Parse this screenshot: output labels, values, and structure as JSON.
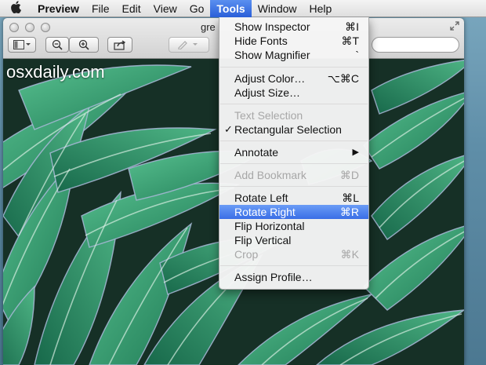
{
  "menubar": {
    "app_name": "Preview",
    "items": [
      "File",
      "Edit",
      "View",
      "Go",
      "Tools",
      "Window",
      "Help"
    ]
  },
  "window": {
    "title_partial": "gre"
  },
  "watermark": "osxdaily.com",
  "tools_menu": {
    "items": [
      {
        "label": "Show Inspector",
        "shortcut": "⌘I"
      },
      {
        "label": "Hide Fonts",
        "shortcut": "⌘T"
      },
      {
        "label": "Show Magnifier",
        "shortcut": "`"
      },
      {
        "label": "Adjust Color…",
        "shortcut": "⌥⌘C"
      },
      {
        "label": "Adjust Size…",
        "shortcut": ""
      },
      {
        "label": "Text Selection",
        "shortcut": ""
      },
      {
        "label": "Rectangular Selection",
        "shortcut": "",
        "checkmark": "✓"
      },
      {
        "label": "Annotate",
        "shortcut": "▶"
      },
      {
        "label": "Add Bookmark",
        "shortcut": "⌘D"
      },
      {
        "label": "Rotate Left",
        "shortcut": "⌘L"
      },
      {
        "label": "Rotate Right",
        "shortcut": "⌘R"
      },
      {
        "label": "Flip Horizontal",
        "shortcut": ""
      },
      {
        "label": "Flip Vertical",
        "shortcut": ""
      },
      {
        "label": "Crop",
        "shortcut": "⌘K"
      },
      {
        "label": "Assign Profile…",
        "shortcut": ""
      }
    ]
  },
  "colors": {
    "menu_highlight": "#3a6ee6",
    "leaf_green": "#2f9a6e"
  }
}
